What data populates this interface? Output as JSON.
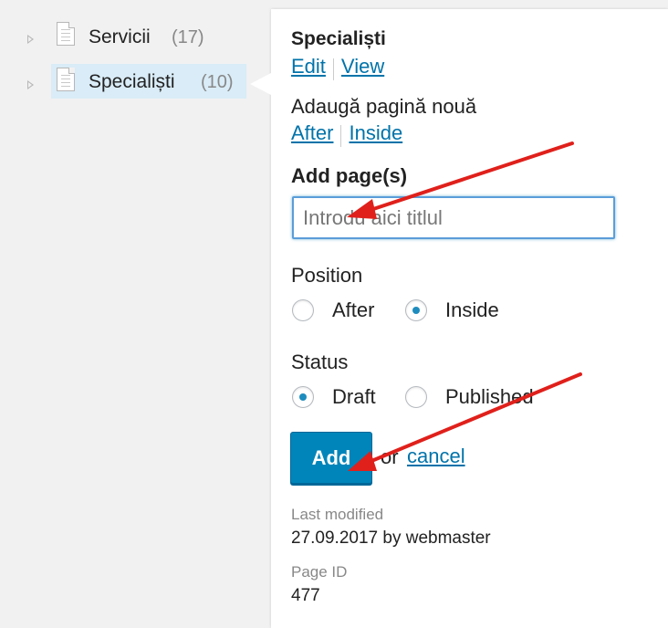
{
  "tree": {
    "items": [
      {
        "label": "Servicii",
        "count": "(17)"
      },
      {
        "label": "Specialiști",
        "count": "(10)"
      }
    ]
  },
  "popup": {
    "page_title": "Specialiști",
    "edit_link": "Edit",
    "view_link": "View",
    "add_new_label": "Adaugă pagină nouă",
    "after_link": "After",
    "inside_link": "Inside",
    "add_pages_heading": "Add page(s)",
    "title_input_placeholder": "Introdu aici titlul",
    "position": {
      "label": "Position",
      "options": [
        "After",
        "Inside"
      ],
      "selected": "Inside"
    },
    "status": {
      "label": "Status",
      "options": [
        "Draft",
        "Published"
      ],
      "selected": "Draft"
    },
    "add_button": "Add",
    "or_text": "or",
    "cancel_link": "cancel",
    "last_modified_label": "Last modified",
    "last_modified_value": "27.09.2017 by webmaster",
    "page_id_label": "Page ID",
    "page_id_value": "477"
  },
  "colors": {
    "link": "#0073aa",
    "button": "#0085ba",
    "annotation_arrow": "#e0201b",
    "selected_row": "#d9ecf7"
  }
}
